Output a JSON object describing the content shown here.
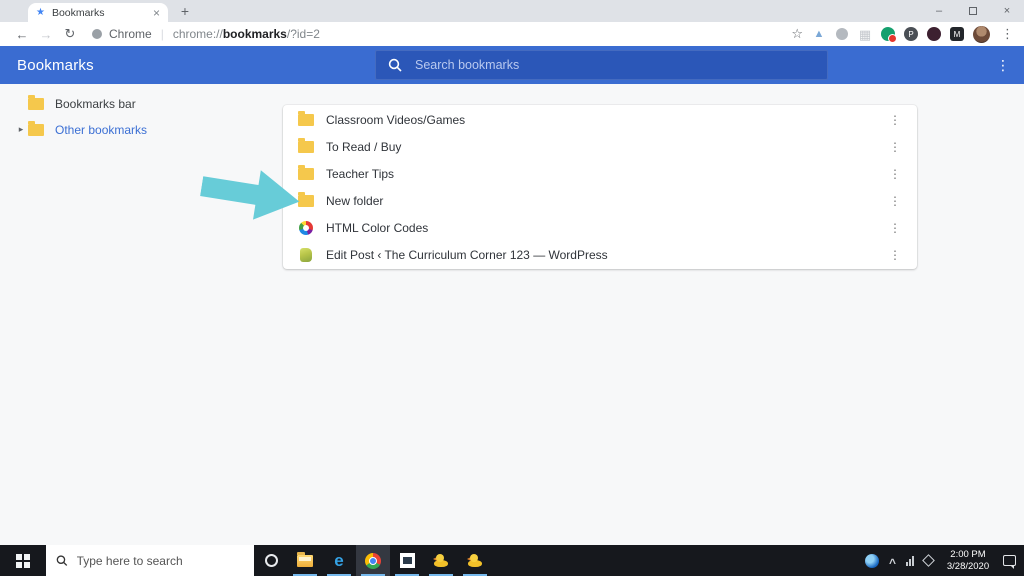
{
  "icons": {
    "tab_favicon": "★",
    "tab_close": "×",
    "new_tab": "+",
    "window_minimize": "–",
    "window_close": "×",
    "nav_back": "←",
    "nav_forward": "→",
    "nav_refresh": "↻",
    "bookmark_star": "☆",
    "kebab_menu": "⋮",
    "expand_triangle": "▸",
    "url_divider": "|",
    "extension_grid": "▦",
    "extension_triangle": "▲",
    "extension_p": "P",
    "extension_m": "M",
    "edge_e": "e",
    "tray_chevron": "^"
  },
  "browser": {
    "tab_title": "Bookmarks",
    "search_engine_label": "Chrome",
    "url_prefix": "chrome://",
    "url_host": "bookmarks",
    "url_suffix": "/?id=2"
  },
  "bookmarks_app": {
    "header_title": "Bookmarks",
    "search_placeholder": "Search bookmarks",
    "sidebar": [
      {
        "label": "Bookmarks bar",
        "selected": false
      },
      {
        "label": "Other bookmarks",
        "selected": true
      }
    ],
    "rows": [
      {
        "label": "Classroom Videos/Games",
        "icon": "folder-icon"
      },
      {
        "label": "To Read / Buy",
        "icon": "folder-icon"
      },
      {
        "label": "Teacher Tips",
        "icon": "folder-icon"
      },
      {
        "label": "New folder",
        "icon": "folder-icon"
      },
      {
        "label": "HTML Color Codes",
        "icon": "color-wheel-favicon"
      },
      {
        "label": "Edit Post ‹ The Curriculum Corner 123 — WordPress",
        "icon": "site-favicon"
      }
    ]
  },
  "annotation": {
    "arrow_points_at": "New folder"
  },
  "taskbar": {
    "search_placeholder": "Type here to search",
    "clock_time": "2:00 PM",
    "clock_date": "3/28/2020"
  },
  "colors": {
    "header_blue": "#3a6cd1",
    "search_box_blue": "#2b57b8",
    "link_blue": "#3b6fd4",
    "folder_yellow": "#f5c84c",
    "arrow_cyan": "#67ccd8",
    "taskbar_dark": "#16181d",
    "active_underline": "#76b9ed"
  }
}
